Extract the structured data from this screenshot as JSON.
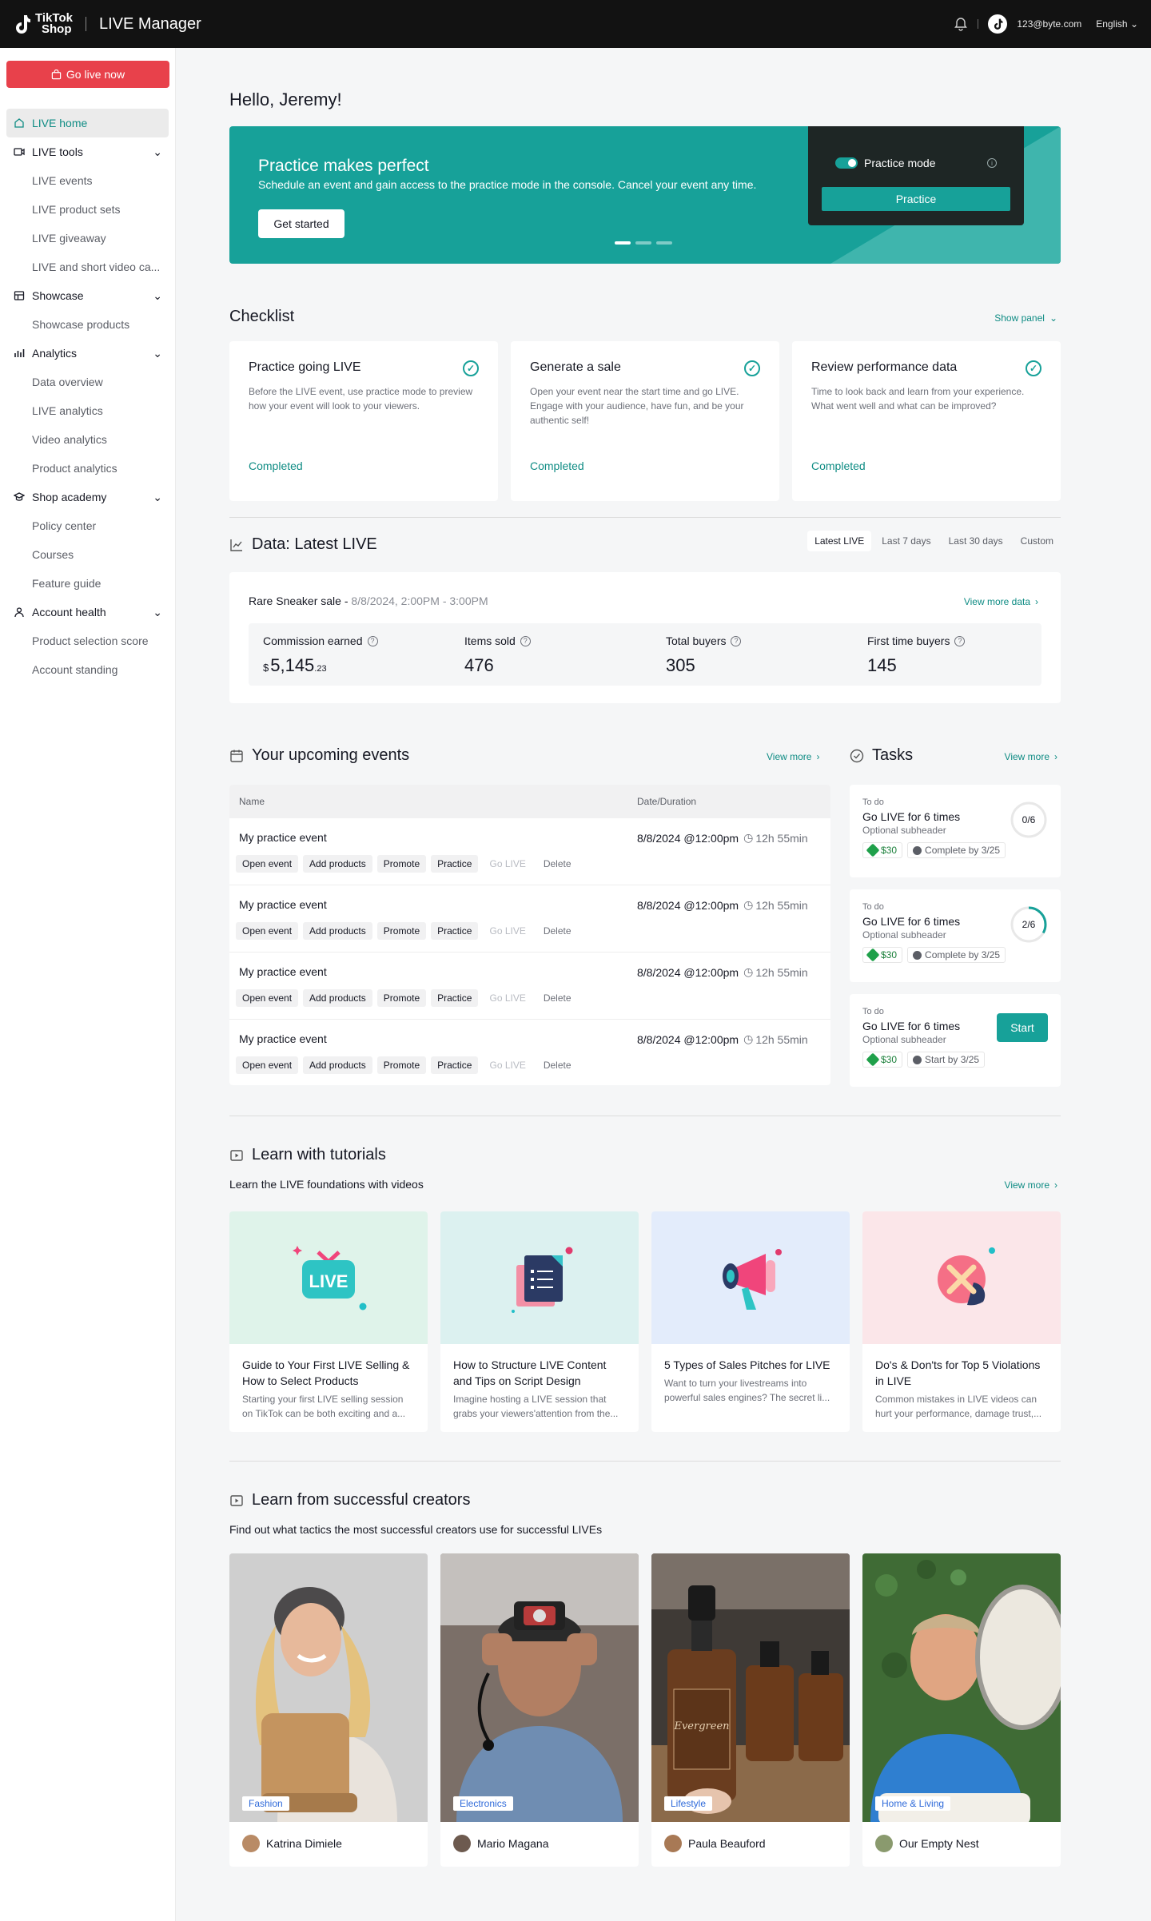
{
  "header": {
    "logo_line1": "TikTok",
    "logo_line2": "Shop",
    "app_title": "LIVE Manager",
    "account_email": "123@byte.com",
    "language": "English"
  },
  "sidebar": {
    "go_live_label": "Go live now",
    "items": [
      {
        "label": "LIVE home"
      },
      {
        "label": "LIVE tools"
      },
      {
        "label": "LIVE events"
      },
      {
        "label": "LIVE product sets"
      },
      {
        "label": "LIVE giveaway"
      },
      {
        "label": "LIVE and short video ca..."
      },
      {
        "label": "Showcase"
      },
      {
        "label": "Showcase products"
      },
      {
        "label": "Analytics"
      },
      {
        "label": "Data overview"
      },
      {
        "label": "LIVE analytics"
      },
      {
        "label": "Video analytics"
      },
      {
        "label": "Product analytics"
      },
      {
        "label": "Shop academy"
      },
      {
        "label": "Policy center"
      },
      {
        "label": "Courses"
      },
      {
        "label": "Feature guide"
      },
      {
        "label": "Account health"
      },
      {
        "label": "Product selection score"
      },
      {
        "label": "Account standing"
      }
    ]
  },
  "greeting": "Hello, Jeremy!",
  "banner": {
    "title": "Practice makes perfect",
    "subtitle": "Schedule an event and gain access to the practice mode in the console. Cancel your event any time.",
    "cta": "Get started",
    "mode_label": "Practice mode",
    "practice_button": "Practice"
  },
  "checklist": {
    "title": "Checklist",
    "show_panel": "Show panel",
    "cards": [
      {
        "title": "Practice going LIVE",
        "desc": "Before the LIVE event, use practice mode to preview how your event will look to your viewers.",
        "status": "Completed"
      },
      {
        "title": "Generate a sale",
        "desc": "Open your event near the start time and go LIVE. Engage with your audience, have fun, and be your authentic self!",
        "status": "Completed"
      },
      {
        "title": "Review performance data",
        "desc": "Time to look back and learn from your experience. What went well and what can be improved?",
        "status": "Completed"
      }
    ]
  },
  "data_section": {
    "title": "Data: Latest LIVE",
    "ranges": [
      "Latest LIVE",
      "Last 7 days",
      "Last 30 days",
      "Custom"
    ],
    "event_name": "Rare Sneaker sale - ",
    "event_time": "8/8/2024, 2:00PM - 3:00PM",
    "view_more": "View more data",
    "metrics": [
      {
        "label": "Commission earned",
        "currency": "$",
        "value": "5,145",
        "decimals": ".23"
      },
      {
        "label": "Items sold",
        "value": "476"
      },
      {
        "label": "Total buyers",
        "value": "305"
      },
      {
        "label": "First time buyers",
        "value": "145"
      }
    ]
  },
  "events": {
    "title": "Your upcoming events",
    "view_more": "View more",
    "columns": [
      "Name",
      "Date/Duration"
    ],
    "actions": [
      "Open event",
      "Add products",
      "Promote",
      "Practice",
      "Go LIVE",
      "Delete"
    ],
    "rows": [
      {
        "name": "My practice event",
        "date": "8/8/2024 @12:00pm",
        "duration": "12h 55min"
      },
      {
        "name": "My practice event",
        "date": "8/8/2024 @12:00pm",
        "duration": "12h 55min"
      },
      {
        "name": "My practice event",
        "date": "8/8/2024 @12:00pm",
        "duration": "12h 55min"
      },
      {
        "name": "My practice event",
        "date": "8/8/2024 @12:00pm",
        "duration": "12h 55min"
      }
    ]
  },
  "tasks": {
    "title": "Tasks",
    "view_more": "View more",
    "items": [
      {
        "status": "To do",
        "title": "Go LIVE for 6 times",
        "subheader": "Optional subheader",
        "reward": "$30",
        "deadline": "Complete by 3/25",
        "progress": "0/6",
        "fraction": 0
      },
      {
        "status": "To do",
        "title": "Go LIVE for 6 times",
        "subheader": "Optional subheader",
        "reward": "$30",
        "deadline": "Complete by 3/25",
        "progress": "2/6",
        "fraction": 0.333
      },
      {
        "status": "To do",
        "title": "Go LIVE for 6 times",
        "subheader": "Optional subheader",
        "reward": "$30",
        "deadline": "Start by 3/25",
        "button": "Start"
      }
    ]
  },
  "tutorials": {
    "title": "Learn with tutorials",
    "desc": "Learn the LIVE foundations with videos",
    "view_more": "View more",
    "cards": [
      {
        "title": "Guide to Your First LIVE Selling & How to Select Products",
        "desc": "Starting your first LIVE selling session on TikTok can be both exciting and a...",
        "art_text": "LIVE",
        "bg": "#dff3ea"
      },
      {
        "title": "How to Structure LIVE Content and Tips on Script Design",
        "desc": "Imagine hosting a LIVE session that grabs your viewers'attention from the...",
        "bg": "#dcf1f0"
      },
      {
        "title": "5 Types of Sales Pitches for LIVE",
        "desc": "Want to turn your livestreams into powerful sales engines? The secret li...",
        "bg": "#e3ecfb"
      },
      {
        "title": "Do's & Don'ts for Top 5 Violations in LIVE",
        "desc": "Common mistakes in LIVE videos can hurt your performance, damage trust,...",
        "bg": "#fbe6e9"
      }
    ]
  },
  "creators": {
    "title": "Learn from successful creators",
    "desc": "Find out what tactics the most successful creators use for successful LIVEs",
    "cards": [
      {
        "name": "Katrina Dimiele",
        "category": "Fashion"
      },
      {
        "name": "Mario Magana",
        "category": "Electronics"
      },
      {
        "name": "Paula Beauford",
        "category": "Lifestyle",
        "bottle_text": "Evergreen"
      },
      {
        "name": "Our Empty Nest",
        "category": "Home & Living"
      }
    ]
  }
}
